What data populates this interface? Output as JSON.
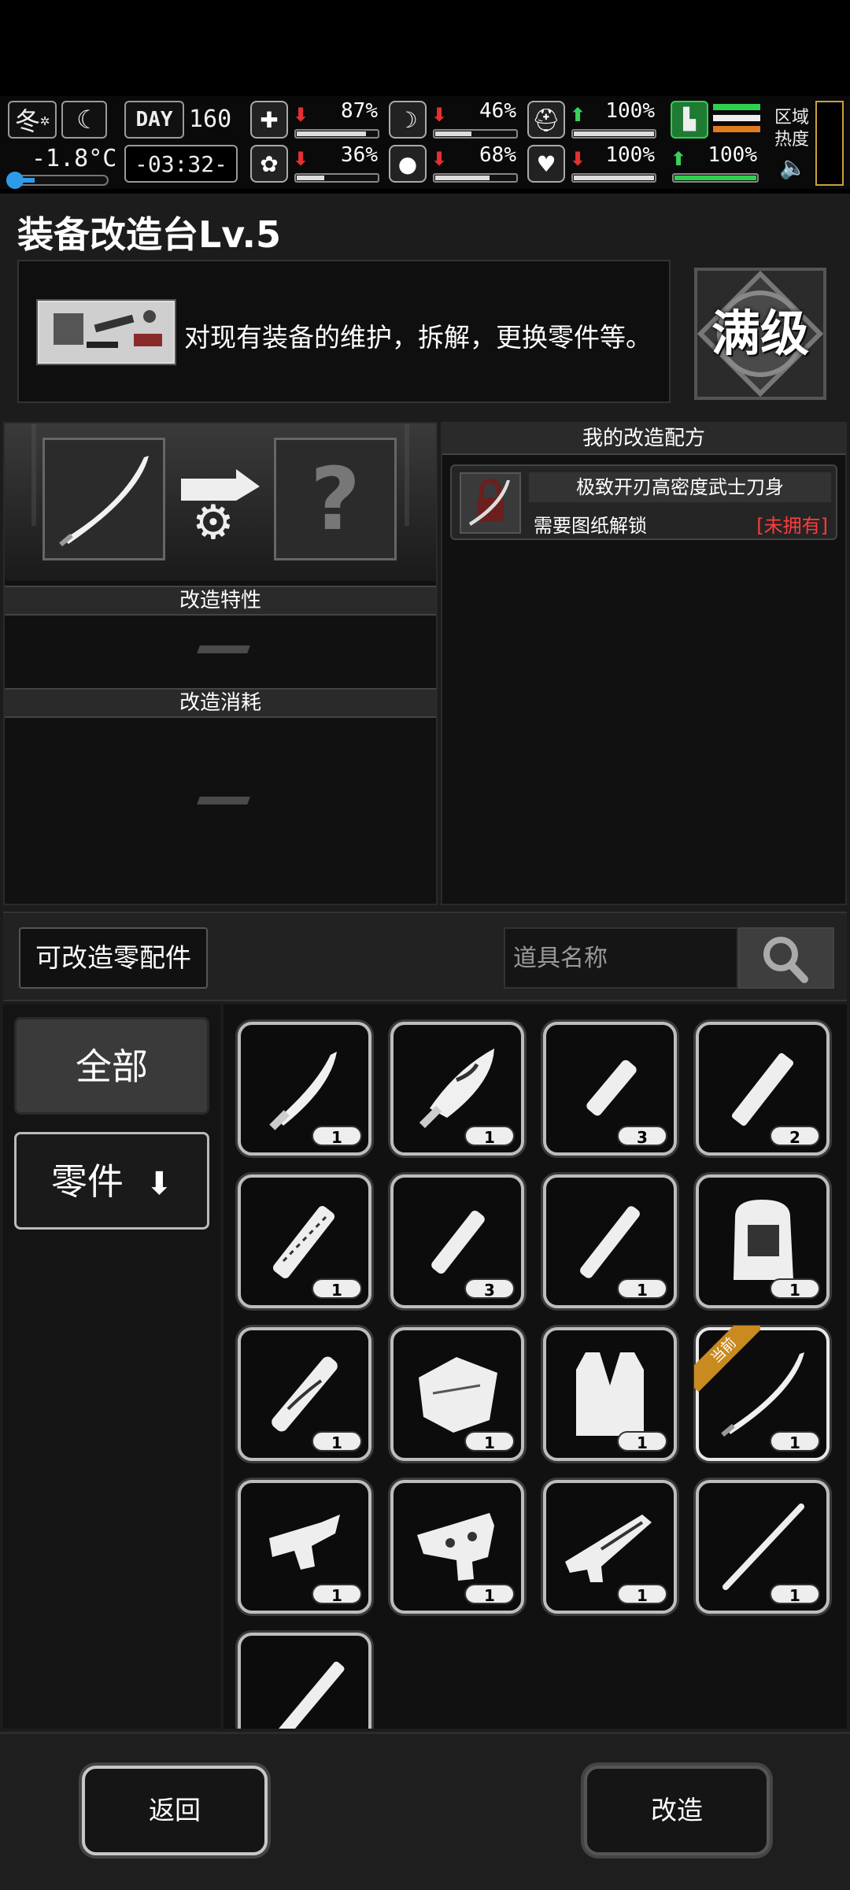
{
  "status": {
    "season": "冬",
    "temperature": "-1.8°C",
    "day_label": "DAY",
    "day_number": "160",
    "clock": "-03:32-",
    "zone_heat_label": "区域热度",
    "stats": [
      {
        "name": "health",
        "icon": "medkit-icon",
        "trend": "down",
        "value": "87%",
        "level": 0.87
      },
      {
        "name": "hunger",
        "icon": "stomach-icon",
        "trend": "down",
        "value": "46%",
        "level": 0.46
      },
      {
        "name": "armor",
        "icon": "helmet-icon",
        "trend": "up",
        "value": "100%",
        "level": 1.0
      },
      {
        "name": "brain",
        "icon": "brain-icon",
        "trend": "down",
        "value": "36%",
        "level": 0.36
      },
      {
        "name": "thirst",
        "icon": "water-drop-icon",
        "trend": "down",
        "value": "68%",
        "level": 0.68
      },
      {
        "name": "heart",
        "icon": "heart-icon",
        "trend": "down",
        "value": "100%",
        "level": 1.0
      },
      {
        "name": "stamina",
        "icon": "boot-icon",
        "trend": "up",
        "value": "100%",
        "level": 1.0
      }
    ]
  },
  "header": {
    "title": "装备改造台Lv.5",
    "description": "对现有装备的维护，拆解，更换零件等。",
    "max_level_badge": "满级"
  },
  "upgrade": {
    "target_slot_icon": "katana-icon",
    "result_slot_label": "?",
    "traits_header": "改造特性",
    "cost_header": "改造消耗"
  },
  "recipes": {
    "header": "我的改造配方",
    "items": [
      {
        "name": "极致开刃高密度武士刀身",
        "requirement": "需要图纸解锁",
        "status": "[未拥有]"
      }
    ]
  },
  "filter": {
    "parts_button": "可改造零配件",
    "search_placeholder": "道具名称"
  },
  "categories": [
    {
      "label": "全部",
      "selected": true
    },
    {
      "label": "零件",
      "selected": false,
      "icon": "arrow-down-icon"
    }
  ],
  "items": [
    {
      "icon": "short-blade-icon",
      "count": "1"
    },
    {
      "icon": "serrated-blade-icon",
      "count": "1"
    },
    {
      "icon": "wrapped-handle-icon",
      "count": "3"
    },
    {
      "icon": "handle-icon",
      "count": "2"
    },
    {
      "icon": "braided-grip-icon",
      "count": "1"
    },
    {
      "icon": "small-handle-icon",
      "count": "3"
    },
    {
      "icon": "tube-handle-icon",
      "count": "1"
    },
    {
      "icon": "backpack-frame-icon",
      "count": "1"
    },
    {
      "icon": "ornate-handle-icon",
      "count": "1"
    },
    {
      "icon": "cloth-wrap-icon",
      "count": "1"
    },
    {
      "icon": "vest-icon",
      "count": "1"
    },
    {
      "icon": "katana-icon",
      "count": "1",
      "current": true,
      "tag": "当前"
    },
    {
      "icon": "pistol-trigger-icon",
      "count": "1"
    },
    {
      "icon": "trigger-group-icon",
      "count": "1"
    },
    {
      "icon": "rifle-receiver-icon",
      "count": "1"
    },
    {
      "icon": "rod-icon",
      "count": "1"
    },
    {
      "icon": "staff-icon",
      "count": ""
    }
  ],
  "actions": {
    "back": "返回",
    "upgrade": "改造"
  }
}
